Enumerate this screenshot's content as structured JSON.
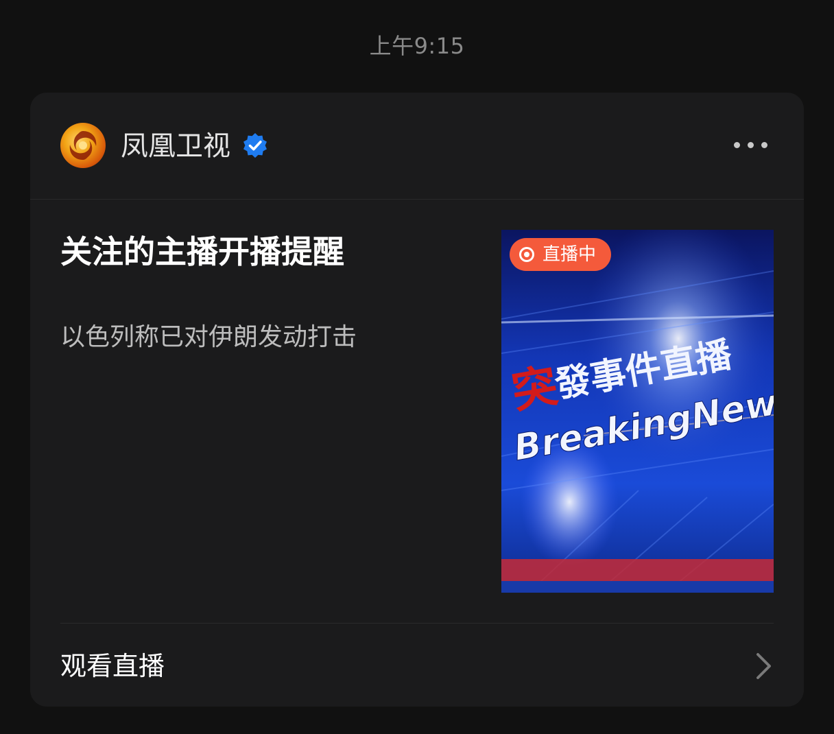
{
  "status": {
    "time": "上午9:15"
  },
  "notification": {
    "account": {
      "name": "凤凰卫视",
      "verified": true,
      "avatar_icon": "phoenix-logo-icon"
    },
    "more_icon": "more-horizontal-icon",
    "title": "关注的主播开播提醒",
    "message": "以色列称已对伊朗发动打击",
    "thumbnail": {
      "live_badge": "直播中",
      "overlay_text_cn": "突發事件直播",
      "overlay_text_en": "BreakingNews"
    },
    "action": {
      "label": "观看直播",
      "icon": "chevron-right-icon"
    }
  },
  "colors": {
    "background": "#111111",
    "card": "#1b1b1c",
    "live_badge": "#f45a3b",
    "verified_badge": "#1f7cf0"
  }
}
